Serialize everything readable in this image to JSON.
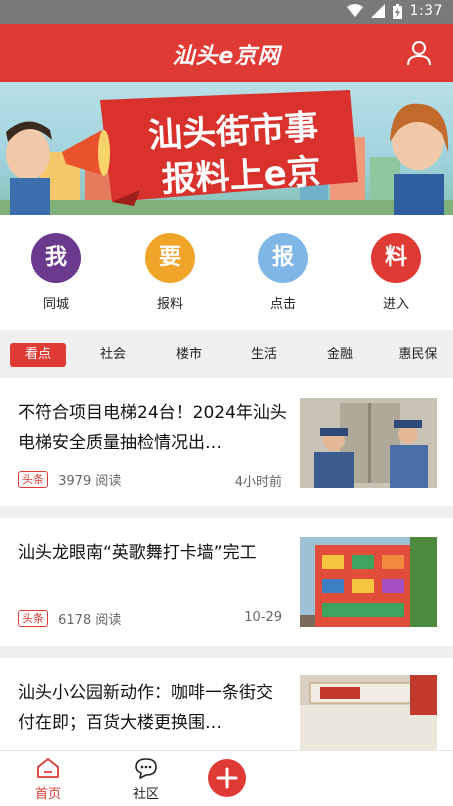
{
  "status_bar": {
    "time": "1:37"
  },
  "header": {
    "logo_text": "汕头e京网",
    "user_icon": "user-icon"
  },
  "banner": {
    "line1": "汕头街市事",
    "line2": "报料上e京"
  },
  "quick_links": [
    {
      "glyph": "我",
      "label": "同城",
      "color": "#6b3a8e"
    },
    {
      "glyph": "要",
      "label": "报料",
      "color": "#f0a52a"
    },
    {
      "glyph": "报",
      "label": "点击",
      "color": "#7eb6e5"
    },
    {
      "glyph": "料",
      "label": "进入",
      "color": "#e03a35"
    }
  ],
  "tabs": [
    "看点",
    "社会",
    "楼市",
    "生活",
    "金融",
    "惠民保"
  ],
  "active_tab": "看点",
  "news": [
    {
      "title": "不符合项目电梯24台！2024年汕头电梯安全质量抽检情况出…",
      "badge": "头条",
      "reads": "3979 阅读",
      "time": "4小时前"
    },
    {
      "title": "汕头龙眼南“英歌舞打卡墙”完工",
      "badge": "头条",
      "reads": "6178 阅读",
      "time": "10-29"
    },
    {
      "title": "汕头小公园新动作：咖啡一条街交付在即；百货大楼更换围…",
      "badge": "",
      "reads": "",
      "time": ""
    }
  ],
  "bottom_nav": {
    "home": "首页",
    "community": "社区"
  },
  "colors": {
    "brand": "#e03a35"
  }
}
